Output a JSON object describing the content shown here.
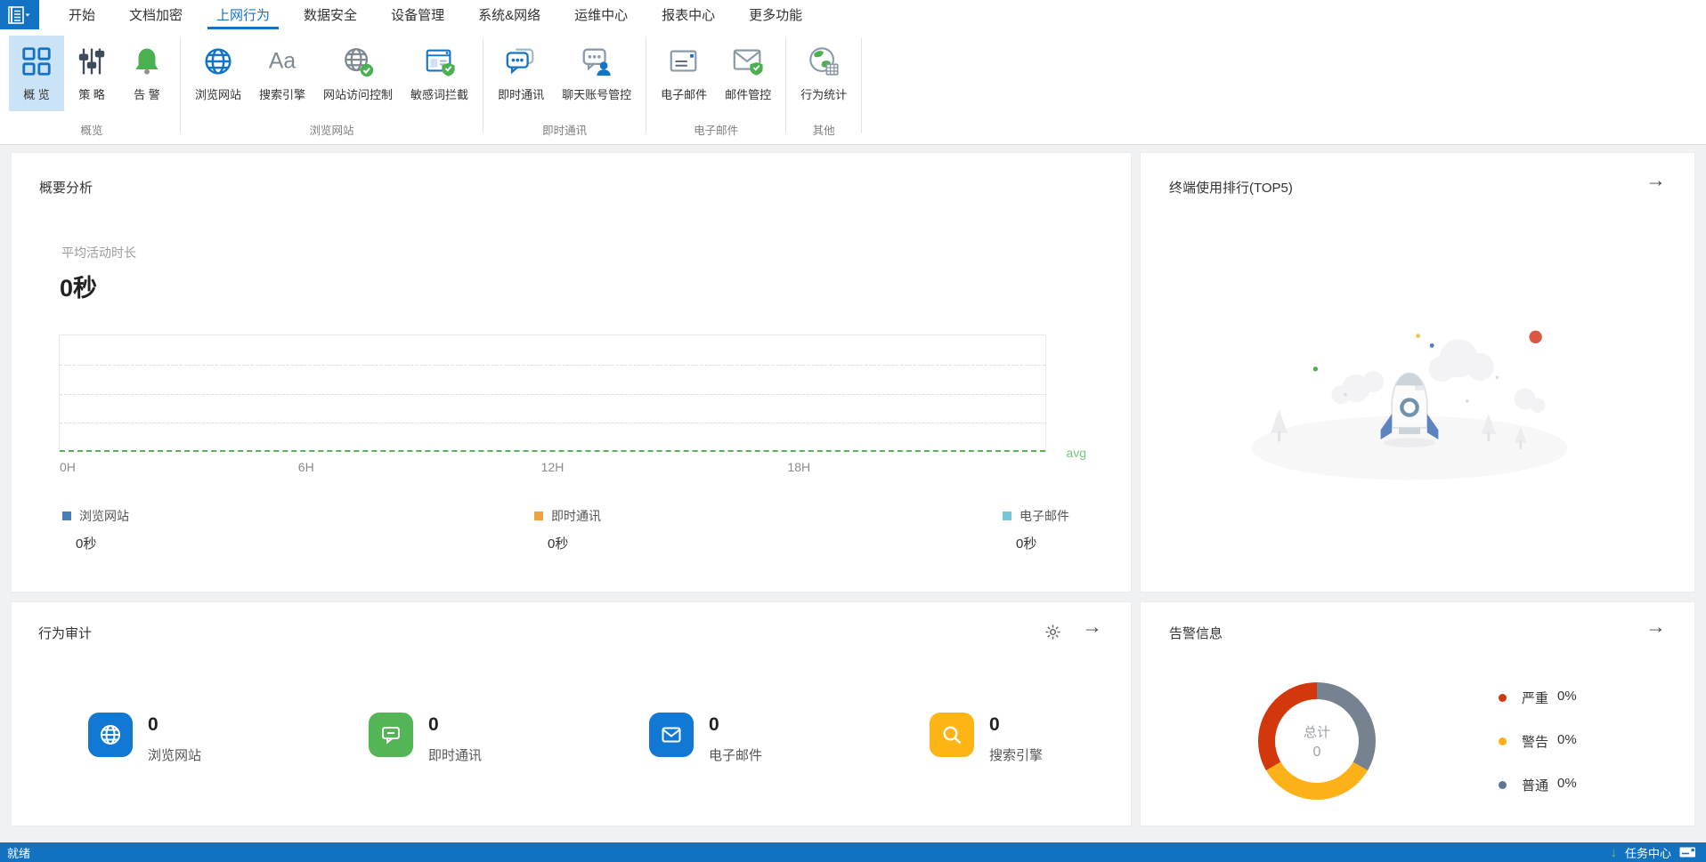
{
  "menu": {
    "tabs": [
      {
        "label": "开始",
        "active": false
      },
      {
        "label": "文档加密",
        "active": false
      },
      {
        "label": "上网行为",
        "active": true
      },
      {
        "label": "数据安全",
        "active": false
      },
      {
        "label": "设备管理",
        "active": false
      },
      {
        "label": "系统&网络",
        "active": false
      },
      {
        "label": "运维中心",
        "active": false
      },
      {
        "label": "报表中心",
        "active": false
      },
      {
        "label": "更多功能",
        "active": false
      }
    ]
  },
  "ribbon": {
    "groups": [
      {
        "label": "概览",
        "buttons": [
          {
            "label": "概 览",
            "icon": "overview-grid",
            "active": true
          },
          {
            "label": "策 略",
            "icon": "policy-sliders",
            "active": false
          },
          {
            "label": "告 警",
            "icon": "alert-bell",
            "active": false
          }
        ]
      },
      {
        "label": "浏览网站",
        "buttons": [
          {
            "label": "浏览网站",
            "icon": "globe",
            "active": false
          },
          {
            "label": "搜索引擎",
            "icon": "font-Aa",
            "active": false
          },
          {
            "label": "网站访问控制",
            "icon": "globe-check",
            "active": false
          },
          {
            "label": "敏感词拦截",
            "icon": "browser-shield",
            "active": false
          }
        ]
      },
      {
        "label": "即时通讯",
        "buttons": [
          {
            "label": "即时通讯",
            "icon": "chat-bubbles",
            "active": false
          },
          {
            "label": "聊天账号管控",
            "icon": "chat-user",
            "active": false
          }
        ]
      },
      {
        "label": "电子邮件",
        "buttons": [
          {
            "label": "电子邮件",
            "icon": "envelope",
            "active": false
          },
          {
            "label": "邮件管控",
            "icon": "envelope-shield",
            "active": false
          }
        ]
      },
      {
        "label": "其他",
        "buttons": [
          {
            "label": "行为统计",
            "icon": "globe-stats",
            "active": false
          }
        ]
      }
    ]
  },
  "summary": {
    "title": "概要分析",
    "metric_label": "平均活动时长",
    "metric_value": "0秒",
    "x_ticks": [
      "0H",
      "6H",
      "12H",
      "18H"
    ],
    "avg_label": "avg",
    "legend": [
      {
        "label": "浏览网站",
        "value": "0秒",
        "color": "#4a7dbb"
      },
      {
        "label": "即时通讯",
        "value": "0秒",
        "color": "#f0a23c"
      },
      {
        "label": "电子邮件",
        "value": "0秒",
        "color": "#74c6d8"
      }
    ]
  },
  "top5": {
    "title": "终端使用排行(TOP5)"
  },
  "audit": {
    "title": "行为审计",
    "items": [
      {
        "value": "0",
        "label": "浏览网站",
        "icon": "globe",
        "color": "#1178d4"
      },
      {
        "value": "0",
        "label": "即时通讯",
        "icon": "chat",
        "color": "#53b555"
      },
      {
        "value": "0",
        "label": "电子邮件",
        "icon": "mail",
        "color": "#1178d4"
      },
      {
        "value": "0",
        "label": "搜索引擎",
        "icon": "search",
        "color": "#fcb514"
      }
    ]
  },
  "alerts": {
    "title": "告警信息",
    "total_label": "总计",
    "total_value": "0",
    "legend": [
      {
        "label": "严重",
        "pct": "0%",
        "color": "#d2380c"
      },
      {
        "label": "警告",
        "pct": "0%",
        "color": "#fbb117"
      },
      {
        "label": "普通",
        "pct": "0%",
        "color": "#5e7391"
      }
    ]
  },
  "statusbar": {
    "ready": "就绪",
    "task_center": "任务中心"
  },
  "colors": {
    "primary_blue": "#1374c5",
    "statusbar_blue": "#1272c2",
    "ribbon_active_bg": "#cbe3f7",
    "green": "#4caf50",
    "avg_line_green": "#58b15b",
    "content_bg": "#f0f1f2"
  },
  "chart_data": [
    {
      "type": "line",
      "title": "平均活动时长",
      "x_ticks": [
        "0H",
        "6H",
        "12H",
        "18H"
      ],
      "x_range_hours": [
        0,
        24
      ],
      "series": [
        {
          "name": "浏览网站",
          "total": "0秒",
          "color": "#4a7dbb",
          "values": []
        },
        {
          "name": "即时通讯",
          "total": "0秒",
          "color": "#f0a23c",
          "values": []
        },
        {
          "name": "电子邮件",
          "total": "0秒",
          "color": "#74c6d8",
          "values": []
        }
      ],
      "avg_line": {
        "label": "avg",
        "value": 0,
        "color": "#58b15b"
      },
      "grid": "horizontal-dashed",
      "note": "empty chart, no data plotted"
    },
    {
      "type": "donut",
      "title": "告警信息",
      "center_label": "总计",
      "center_value": "0",
      "slices": [
        {
          "label": "严重",
          "pct": 0,
          "color": "#d2380c"
        },
        {
          "label": "警告",
          "pct": 0,
          "color": "#fbb117"
        },
        {
          "label": "普通",
          "pct": 0,
          "color": "#76828f"
        }
      ],
      "rendered_as_equal_thirds": true,
      "legend_position": "right"
    }
  ]
}
